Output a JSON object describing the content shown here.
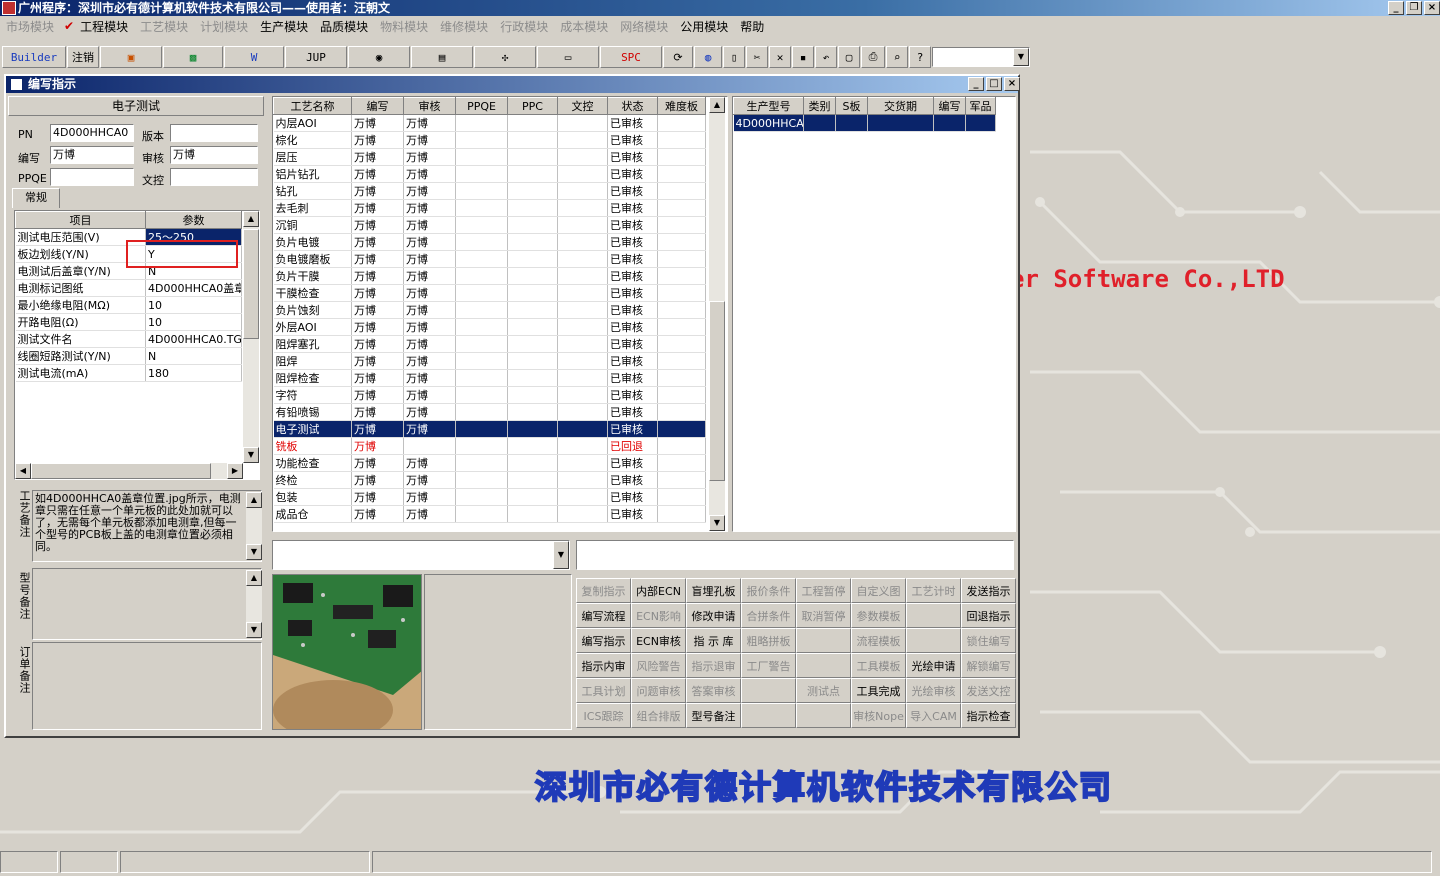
{
  "app_title": "广州程序：深圳市必有德计算机软件技术有限公司——使用者：汪朝文",
  "menu": [
    {
      "label": "市场模块",
      "enabled": false
    },
    {
      "label": "工程模块",
      "enabled": true
    },
    {
      "label": "工艺模块",
      "enabled": false
    },
    {
      "label": "计划模块",
      "enabled": false
    },
    {
      "label": "生产模块",
      "enabled": true
    },
    {
      "label": "品质模块",
      "enabled": true
    },
    {
      "label": "物料模块",
      "enabled": false
    },
    {
      "label": "维修模块",
      "enabled": false
    },
    {
      "label": "行政模块",
      "enabled": false
    },
    {
      "label": "成本模块",
      "enabled": false
    },
    {
      "label": "网络模块",
      "enabled": false
    },
    {
      "label": "公用模块",
      "enabled": true
    },
    {
      "label": "帮助",
      "enabled": true
    }
  ],
  "toolbar": {
    "builder": "Builder",
    "logout": "注销",
    "jup": "JUP",
    "spc": "SPC"
  },
  "window": {
    "title": "编写指示"
  },
  "left": {
    "process_name": "电子测试",
    "pn_label": "PN",
    "pn_value": "4D000HHCA0",
    "version_label": "版本",
    "version_value": "",
    "writer_label": "编写",
    "writer_value": "万博",
    "reviewer_label": "审核",
    "reviewer_value": "万博",
    "ppqe_label": "PPQE",
    "ppqe_value": "",
    "wenkong_label": "文控",
    "wenkong_value": "",
    "tab_label": "常规",
    "param_headers": [
      "项目",
      "参数"
    ],
    "params": [
      {
        "item": "测试电压范围(V)",
        "value": "25～250",
        "selected": true
      },
      {
        "item": "板边划线(Y/N)",
        "value": "Y"
      },
      {
        "item": "电测试后盖章(Y/N)",
        "value": "N"
      },
      {
        "item": "电测标记图纸",
        "value": "4D000HHCA0盖章"
      },
      {
        "item": "最小绝缘电阻(MΩ)",
        "value": "10"
      },
      {
        "item": "开路电阻(Ω)",
        "value": "10"
      },
      {
        "item": "测试文件名",
        "value": "4D000HHCA0.TGZ"
      },
      {
        "item": "线圈短路测试(Y/N)",
        "value": "N"
      },
      {
        "item": "测试电流(mA)",
        "value": "180"
      }
    ],
    "process_note_label": "工艺备注",
    "process_note": "如4D000HHCA0盖章位置.jpg所示，电测章只需在任意一个单元板的此处加就可以了，无需每个单元板都添加电测章,但每一个型号的PCB板上盖的电测章位置必须相同。",
    "model_note_label": "型号备注",
    "order_note_label": "订单备注"
  },
  "process_table": {
    "headers": [
      "工艺名称",
      "编写",
      "审核",
      "PPQE",
      "PPC",
      "文控",
      "状态",
      "难度板"
    ],
    "rows": [
      {
        "name": "内层AOI",
        "writer": "万博",
        "reviewer": "万博",
        "status": "已审核"
      },
      {
        "name": "棕化",
        "writer": "万博",
        "reviewer": "万博",
        "status": "已审核"
      },
      {
        "name": "层压",
        "writer": "万博",
        "reviewer": "万博",
        "status": "已审核"
      },
      {
        "name": "铝片钻孔",
        "writer": "万博",
        "reviewer": "万博",
        "status": "已审核"
      },
      {
        "name": "钻孔",
        "writer": "万博",
        "reviewer": "万博",
        "status": "已审核"
      },
      {
        "name": "去毛刺",
        "writer": "万博",
        "reviewer": "万博",
        "status": "已审核"
      },
      {
        "name": "沉铜",
        "writer": "万博",
        "reviewer": "万博",
        "status": "已审核"
      },
      {
        "name": "负片电镀",
        "writer": "万博",
        "reviewer": "万博",
        "status": "已审核"
      },
      {
        "name": "负电镀磨板",
        "writer": "万博",
        "reviewer": "万博",
        "status": "已审核"
      },
      {
        "name": "负片干膜",
        "writer": "万博",
        "reviewer": "万博",
        "status": "已审核"
      },
      {
        "name": "干膜检查",
        "writer": "万博",
        "reviewer": "万博",
        "status": "已审核"
      },
      {
        "name": "负片蚀刻",
        "writer": "万博",
        "reviewer": "万博",
        "status": "已审核"
      },
      {
        "name": "外层AOI",
        "writer": "万博",
        "reviewer": "万博",
        "status": "已审核"
      },
      {
        "name": "阻焊塞孔",
        "writer": "万博",
        "reviewer": "万博",
        "status": "已审核"
      },
      {
        "name": "阻焊",
        "writer": "万博",
        "reviewer": "万博",
        "status": "已审核"
      },
      {
        "name": "阻焊检查",
        "writer": "万博",
        "reviewer": "万博",
        "status": "已审核"
      },
      {
        "name": "字符",
        "writer": "万博",
        "reviewer": "万博",
        "status": "已审核"
      },
      {
        "name": "有铅喷锡",
        "writer": "万博",
        "reviewer": "万博",
        "status": "已审核"
      },
      {
        "name": "电子测试",
        "writer": "万博",
        "reviewer": "万博",
        "status": "已审核",
        "selected": true
      },
      {
        "name": "铣板",
        "writer": "万博",
        "reviewer": "",
        "status": "已回退",
        "returned": true
      },
      {
        "name": "功能检查",
        "writer": "万博",
        "reviewer": "万博",
        "status": "已审核"
      },
      {
        "name": "终检",
        "writer": "万博",
        "reviewer": "万博",
        "status": "已审核"
      },
      {
        "name": "包装",
        "writer": "万博",
        "reviewer": "万博",
        "status": "已审核"
      },
      {
        "name": "成品仓",
        "writer": "万博",
        "reviewer": "万博",
        "status": "已审核"
      }
    ]
  },
  "model_table": {
    "headers": [
      "生产型号",
      "类别",
      "S板",
      "交货期",
      "编写",
      "军品"
    ],
    "rows": [
      {
        "model": "4D000HHCA0"
      }
    ]
  },
  "buttons": [
    [
      {
        "label": "复制指示",
        "enabled": false
      },
      {
        "label": "内部ECN",
        "enabled": true
      },
      {
        "label": "盲埋孔板",
        "enabled": true
      },
      {
        "label": "报价条件",
        "enabled": false
      },
      {
        "label": "工程暂停",
        "enabled": false
      },
      {
        "label": "自定义图",
        "enabled": false
      },
      {
        "label": "工艺计时",
        "enabled": false
      },
      {
        "label": "发送指示",
        "enabled": true
      }
    ],
    [
      {
        "label": "编写流程",
        "enabled": true
      },
      {
        "label": "ECN影响",
        "enabled": false
      },
      {
        "label": "修改申请",
        "enabled": true
      },
      {
        "label": "合拼条件",
        "enabled": false
      },
      {
        "label": "取消暂停",
        "enabled": false
      },
      {
        "label": "参数模板",
        "enabled": false
      },
      {
        "label": "",
        "enabled": false
      },
      {
        "label": "回退指示",
        "enabled": true
      }
    ],
    [
      {
        "label": "编写指示",
        "enabled": true
      },
      {
        "label": "ECN审核",
        "enabled": true
      },
      {
        "label": "指 示 库",
        "enabled": true
      },
      {
        "label": "粗略拼板",
        "enabled": false
      },
      {
        "label": "",
        "enabled": false
      },
      {
        "label": "流程模板",
        "enabled": false
      },
      {
        "label": "",
        "enabled": false
      },
      {
        "label": "锁住编写",
        "enabled": false
      }
    ],
    [
      {
        "label": "指示内审",
        "enabled": true
      },
      {
        "label": "风险警告",
        "enabled": false
      },
      {
        "label": "指示退审",
        "enabled": false
      },
      {
        "label": "工厂警告",
        "enabled": false
      },
      {
        "label": "",
        "enabled": false
      },
      {
        "label": "工具模板",
        "enabled": false
      },
      {
        "label": "光绘申请",
        "enabled": true
      },
      {
        "label": "解锁编写",
        "enabled": false
      }
    ],
    [
      {
        "label": "工具计划",
        "enabled": false
      },
      {
        "label": "问题审核",
        "enabled": false
      },
      {
        "label": "答案审核",
        "enabled": false
      },
      {
        "label": "",
        "enabled": false
      },
      {
        "label": "测试点",
        "enabled": false
      },
      {
        "label": "工具完成",
        "enabled": true
      },
      {
        "label": "光绘审核",
        "enabled": false
      },
      {
        "label": "发送文控",
        "enabled": false
      }
    ],
    [
      {
        "label": "ICS跟踪",
        "enabled": false
      },
      {
        "label": "组合排版",
        "enabled": false
      },
      {
        "label": "型号备注",
        "enabled": true
      },
      {
        "label": "",
        "enabled": false
      },
      {
        "label": "",
        "enabled": false
      },
      {
        "label": "审核Nope",
        "enabled": false
      },
      {
        "label": "导入CAM",
        "enabled": false
      },
      {
        "label": "指示检查",
        "enabled": true
      }
    ]
  ],
  "background": {
    "software_text": "er Software Co.,LTD",
    "company_text": "深圳市必有德计算机软件技术有限公司"
  }
}
